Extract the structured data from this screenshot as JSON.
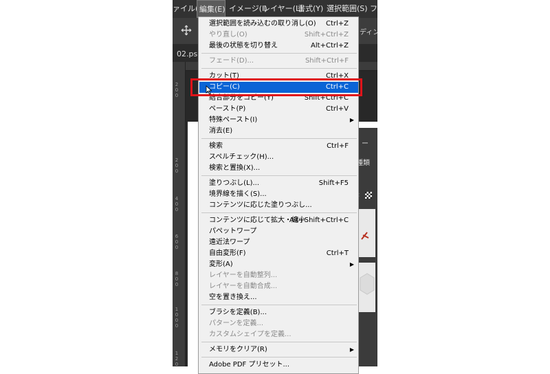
{
  "menubar": {
    "items": [
      {
        "label": "ァイル(F)"
      },
      {
        "label": "編集(E)"
      },
      {
        "label": "イメージ(I)"
      },
      {
        "label": "レイヤー(L)"
      },
      {
        "label": "書式(Y)"
      },
      {
        "label": "選択範囲(S)"
      },
      {
        "label": "フィ"
      }
    ]
  },
  "options_bar": {
    "move_icon": "move-icon",
    "partial_label": "ディング"
  },
  "document": {
    "tab_label": "02.ps"
  },
  "ruler": {
    "left_numbers": [
      "2",
      "0",
      "0",
      "2",
      "0",
      "0",
      "4",
      "0",
      "0",
      "6",
      "0",
      "0",
      "8",
      "0",
      "0",
      "1",
      "0",
      "0",
      "0",
      "1",
      "2",
      "0",
      "0"
    ]
  },
  "panel": {
    "partial_tab": "ー",
    "partial_kind": "種類",
    "partial_colon": ":"
  },
  "edit_menu": {
    "groups": [
      [
        {
          "label": "選択範囲を読み込むの取り消し(O)",
          "shortcut": "Ctrl+Z",
          "disabled": false
        },
        {
          "label": "やり直し(O)",
          "shortcut": "Shift+Ctrl+Z",
          "disabled": true
        },
        {
          "label": "最後の状態を切り替え",
          "shortcut": "Alt+Ctrl+Z",
          "disabled": false
        }
      ],
      [
        {
          "label": "フェード(D)...",
          "shortcut": "Shift+Ctrl+F",
          "disabled": true
        }
      ],
      [
        {
          "label": "カット(T)",
          "shortcut": "Ctrl+X",
          "disabled": false
        },
        {
          "label": "コピー(C)",
          "shortcut": "Ctrl+C",
          "disabled": false,
          "highlighted": true
        },
        {
          "label": "結合部分をコピー(Y)",
          "shortcut": "Shift+Ctrl+C",
          "disabled": false
        },
        {
          "label": "ペースト(P)",
          "shortcut": "Ctrl+V",
          "disabled": false
        },
        {
          "label": "特殊ペースト(I)",
          "shortcut": "",
          "disabled": false,
          "submenu": true
        },
        {
          "label": "消去(E)",
          "shortcut": "",
          "disabled": false
        }
      ],
      [
        {
          "label": "検索",
          "shortcut": "Ctrl+F",
          "disabled": false
        },
        {
          "label": "スペルチェック(H)...",
          "shortcut": "",
          "disabled": false
        },
        {
          "label": "検索と置換(X)...",
          "shortcut": "",
          "disabled": false
        }
      ],
      [
        {
          "label": "塗りつぶし(L)...",
          "shortcut": "Shift+F5",
          "disabled": false
        },
        {
          "label": "境界線を描く(S)...",
          "shortcut": "",
          "disabled": false
        },
        {
          "label": "コンテンツに応じた塗りつぶし...",
          "shortcut": "",
          "disabled": false
        }
      ],
      [
        {
          "label": "コンテンツに応じて拡大・縮小",
          "shortcut": "Alt+Shift+Ctrl+C",
          "disabled": false
        },
        {
          "label": "パペットワープ",
          "shortcut": "",
          "disabled": false
        },
        {
          "label": "遠近法ワープ",
          "shortcut": "",
          "disabled": false
        },
        {
          "label": "自由変形(F)",
          "shortcut": "Ctrl+T",
          "disabled": false
        },
        {
          "label": "変形(A)",
          "shortcut": "",
          "disabled": false,
          "submenu": true
        },
        {
          "label": "レイヤーを自動整列...",
          "shortcut": "",
          "disabled": true
        },
        {
          "label": "レイヤーを自動合成...",
          "shortcut": "",
          "disabled": true
        },
        {
          "label": "空を置き換え...",
          "shortcut": "",
          "disabled": false
        }
      ],
      [
        {
          "label": "ブラシを定義(B)...",
          "shortcut": "",
          "disabled": false
        },
        {
          "label": "パターンを定義...",
          "shortcut": "",
          "disabled": true
        },
        {
          "label": "カスタムシェイプを定義...",
          "shortcut": "",
          "disabled": true
        }
      ],
      [
        {
          "label": "メモリをクリア(R)",
          "shortcut": "",
          "disabled": false,
          "submenu": true
        }
      ],
      [
        {
          "label": "Adobe PDF プリセット...",
          "shortcut": "",
          "disabled": false
        }
      ]
    ]
  },
  "annotation": {
    "color": "#e0141a"
  },
  "colors": {
    "menu_highlight": "#0a64d6",
    "menu_bg": "#f0f0f0",
    "app_dark": "#323232"
  }
}
